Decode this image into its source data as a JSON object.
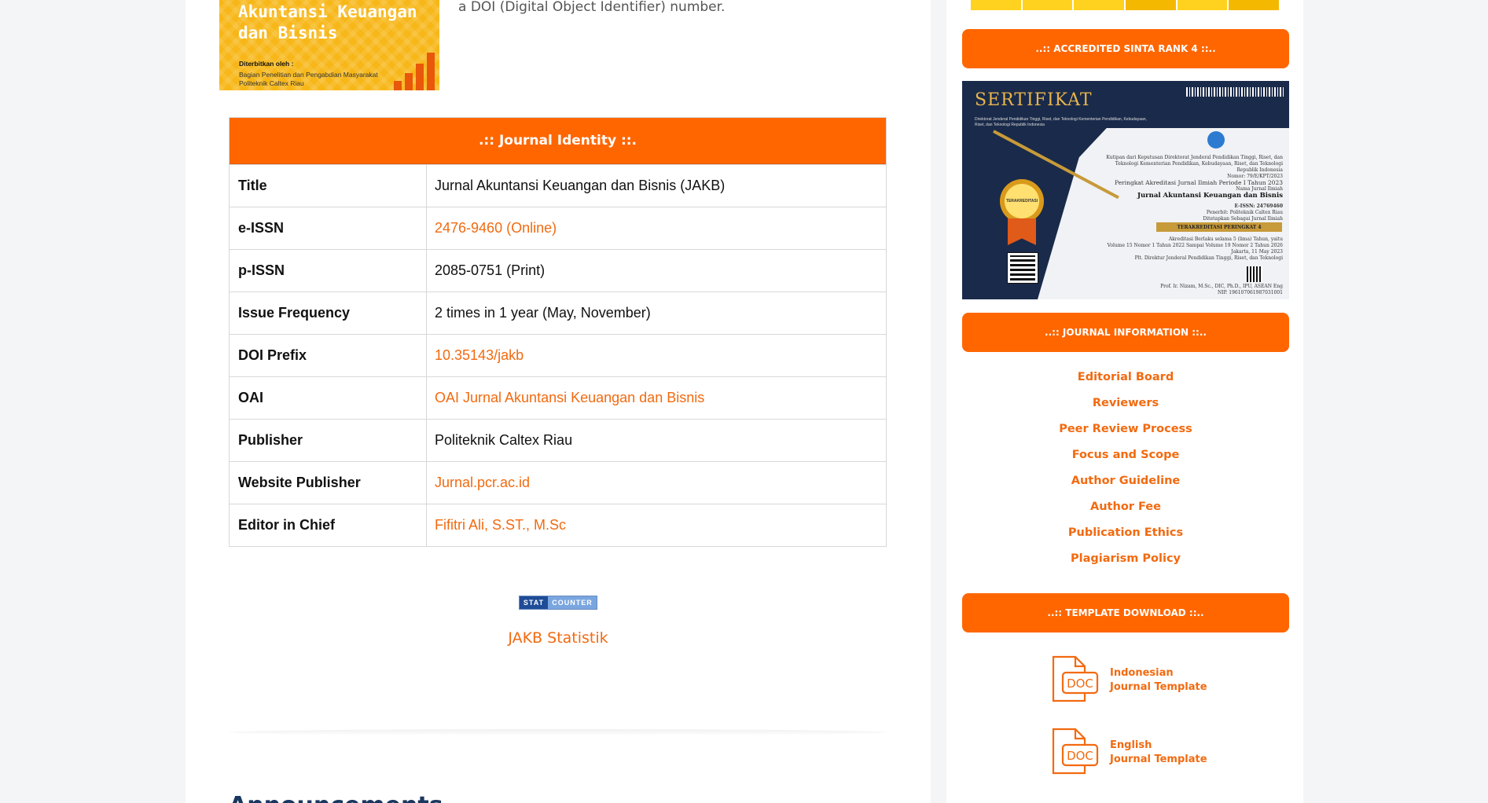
{
  "cover": {
    "title_line1": "Akuntansi Keuangan",
    "title_line2": "dan Bisnis",
    "published_by": "Diterbitkan oleh :",
    "publisher_line1": "Bagian Penelitian dan Pengabdian Masyarakat",
    "publisher_line2": "Politeknik Caltex Riau"
  },
  "intro_text": "a DOI (Digital Object Identifier) number.",
  "identity": {
    "header": ".:: Journal Identity ::.",
    "rows": [
      {
        "key": "Title",
        "value": "Jurnal Akuntansi Keuangan dan Bisnis (JAKB)"
      },
      {
        "key": "e-ISSN",
        "value": "2476-9460 (Online)"
      },
      {
        "key": "p-ISSN",
        "value": "2085-0751 (Print)"
      },
      {
        "key": "Issue Frequency",
        "value": "2 times in 1 year (May, November)"
      },
      {
        "key": "DOI Prefix",
        "value": "10.35143/jakb"
      },
      {
        "key": "OAI",
        "value": "OAI Jurnal Akuntansi Keuangan dan Bisnis"
      },
      {
        "key": "Publisher",
        "value": "Politeknik Caltex Riau"
      },
      {
        "key": "Website Publisher",
        "value": "Jurnal.pcr.ac.id"
      },
      {
        "key": "Editor in Chief",
        "value": "Fifitri Ali, S.ST., M.Sc"
      }
    ]
  },
  "statcounter": {
    "left": "STAT",
    "right": "COUNTER"
  },
  "stat_link": "JAKB Statistik",
  "announcements": "Announcements",
  "sidebar": {
    "accredited_header": "..:: ACCREDITED SINTA RANK 4 ::..",
    "certificate": {
      "title": "SERTIFIKAT",
      "issuer": "Direktorat Jenderal Pendidikan Tinggi, Riset, dan Teknologi Kementerian Pendidikan, Kebudayaan, Riset, dan Teknologi Republik Indonesia",
      "decree": "Kutipan dari Keputusan Direktorat Jenderal Pendidikan Tinggi, Riset, dan Teknologi Kementerian Pendidikan, Kebudayaan, Riset, dan Teknologi Republik Indonesia",
      "number": "Nomor: 79/E/KPT/2023",
      "period": "Peringkat Akreditasi Jurnal Ilmiah Periode I Tahun 2023",
      "journal_label": "Nama Jurnal Ilmiah",
      "journal_name": "Jurnal Akuntansi Keuangan dan Bisnis",
      "eissn": "E-ISSN: 24769460",
      "publisher": "Penerbit: Politeknik Caltex Riau",
      "designated": "Ditetapkan Sebagai Jurnal Ilmiah",
      "rank": "TERAKREDITASI PERINGKAT 4",
      "medal": "TERAKREDITASI",
      "validity_line1": "Akreditasi Berlaku selama 5 (lima) Tahun, yaitu",
      "validity_line2": "Volume 15 Nomor 1 Tahun 2022 Sampai Volume 19 Nomor 2 Tahun 2026",
      "place_date": "Jakarta, 11 May 2023",
      "signer_title": "Plt. Direktur Jenderal Pendidikan Tinggi, Riset, dan Teknologi",
      "signer_name": "Prof. Ir. Nizam, M.Sc., DIC, Ph.D., IPU, ASEAN Eng",
      "signer_nip": "NIP. 196107061987031001"
    },
    "info_header": "..:: JOURNAL INFORMATION ::..",
    "info_links": [
      "Editorial Board",
      "Reviewers",
      "Peer Review Process",
      "Focus and Scope",
      "Author Guideline",
      "Author Fee",
      "Publication Ethics",
      "Plagiarism Policy"
    ],
    "template_header": "..:: TEMPLATE DOWNLOAD ::..",
    "templates": [
      {
        "line1": "Indonesian",
        "line2": "Journal Template",
        "icon": "DOC"
      },
      {
        "line1": "English",
        "line2": "Journal Template",
        "icon": "DOC"
      }
    ]
  },
  "colors": {
    "accent": "#ff6600",
    "link": "#f26a10",
    "cover": "#f7b718"
  }
}
